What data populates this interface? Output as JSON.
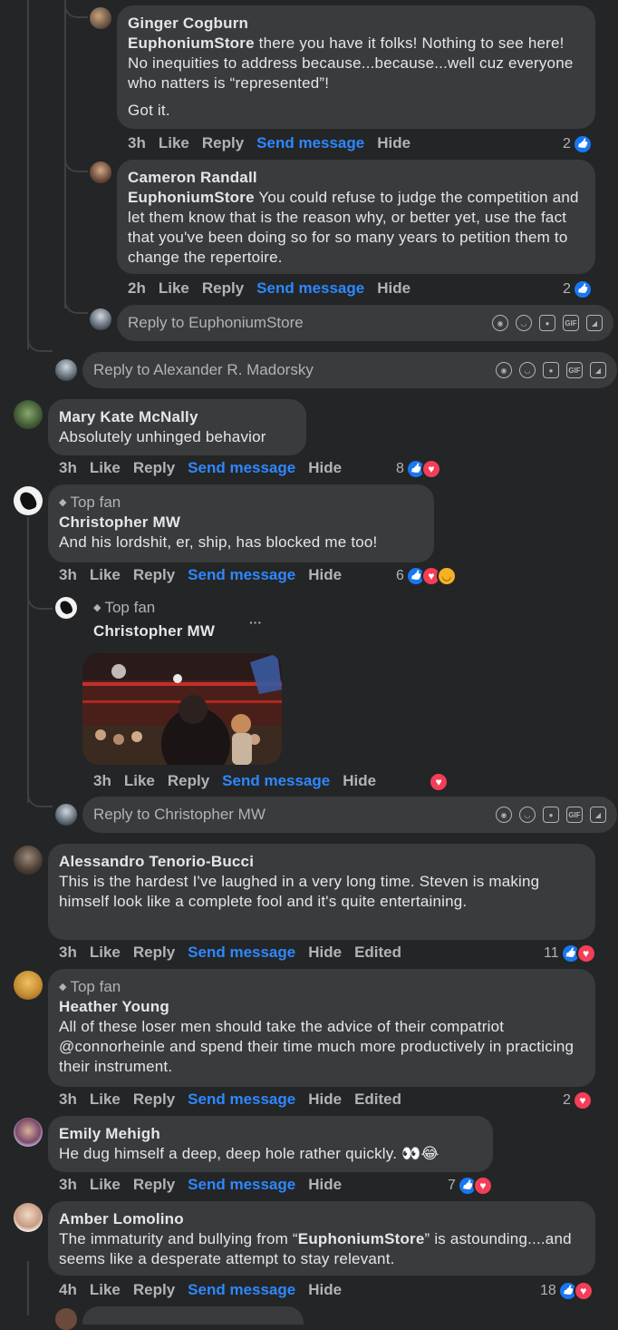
{
  "actions": {
    "like": "Like",
    "reply": "Reply",
    "send": "Send message",
    "hide": "Hide",
    "edited": "Edited"
  },
  "top_fan": "Top fan",
  "more": "···",
  "reply_boxes": {
    "euphonium": "Reply to EuphoniumStore",
    "madorsky": "Reply to Alexander R. Madorsky",
    "christopher": "Reply to Christopher MW"
  },
  "composer_icons": [
    "avatar-sticker-icon",
    "emoji-icon",
    "camera-icon",
    "gif-icon",
    "sticker-icon"
  ],
  "gif_label": "GIF",
  "comments": [
    {
      "name": "Ginger Cogburn",
      "mention": "EuphoniumStore",
      "text": " there you have it folks! Nothing to see here! No inequities to address because...because...well cuz everyone who natters is “represented”!",
      "text2": "Got it.",
      "time": "3h",
      "reactions": "2"
    },
    {
      "name": "Cameron Randall",
      "mention": "EuphoniumStore",
      "text": " You could refuse to judge the competition and let them know that is the reason why, or better yet, use the fact that you've been doing so for so many years to petition them to change the repertoire.",
      "time": "2h",
      "reactions": "2"
    },
    {
      "name": "Mary Kate McNally",
      "text": "Absolutely unhinged behavior",
      "time": "3h",
      "reactions": "8"
    },
    {
      "name": "Christopher MW",
      "text": "And his lordshit, er, ship, has blocked me too!",
      "time": "3h",
      "reactions": "6"
    },
    {
      "name": "Christopher MW",
      "time": "3h"
    },
    {
      "name": "Alessandro Tenorio-Bucci",
      "text": "This is the hardest I've laughed in a very long time. Steven is making himself look like a complete fool and it's quite entertaining.",
      "time": "3h",
      "reactions": "11"
    },
    {
      "name": "Heather Young",
      "text": "All of these loser men should take the advice of their compatriot @connorheinle and spend their time much more productively in practicing their instrument.",
      "time": "3h",
      "reactions": "2"
    },
    {
      "name": "Emily Mehigh",
      "text": "He dug himself a deep, deep hole rather quickly. 👀😂",
      "time": "3h",
      "reactions": "7"
    },
    {
      "name": "Amber Lomolino",
      "text_pre": "The immaturity and bullying from “",
      "mention": "EuphoniumStore",
      "text_post": "” is astounding....and seems like a desperate attempt to stay relevant.",
      "time": "4h",
      "reactions": "18"
    }
  ],
  "colors": {
    "bg": "#242526",
    "bubble": "#3a3b3c",
    "link": "#2d88ff",
    "muted": "#b0b3b8",
    "text": "#e4e6eb"
  }
}
